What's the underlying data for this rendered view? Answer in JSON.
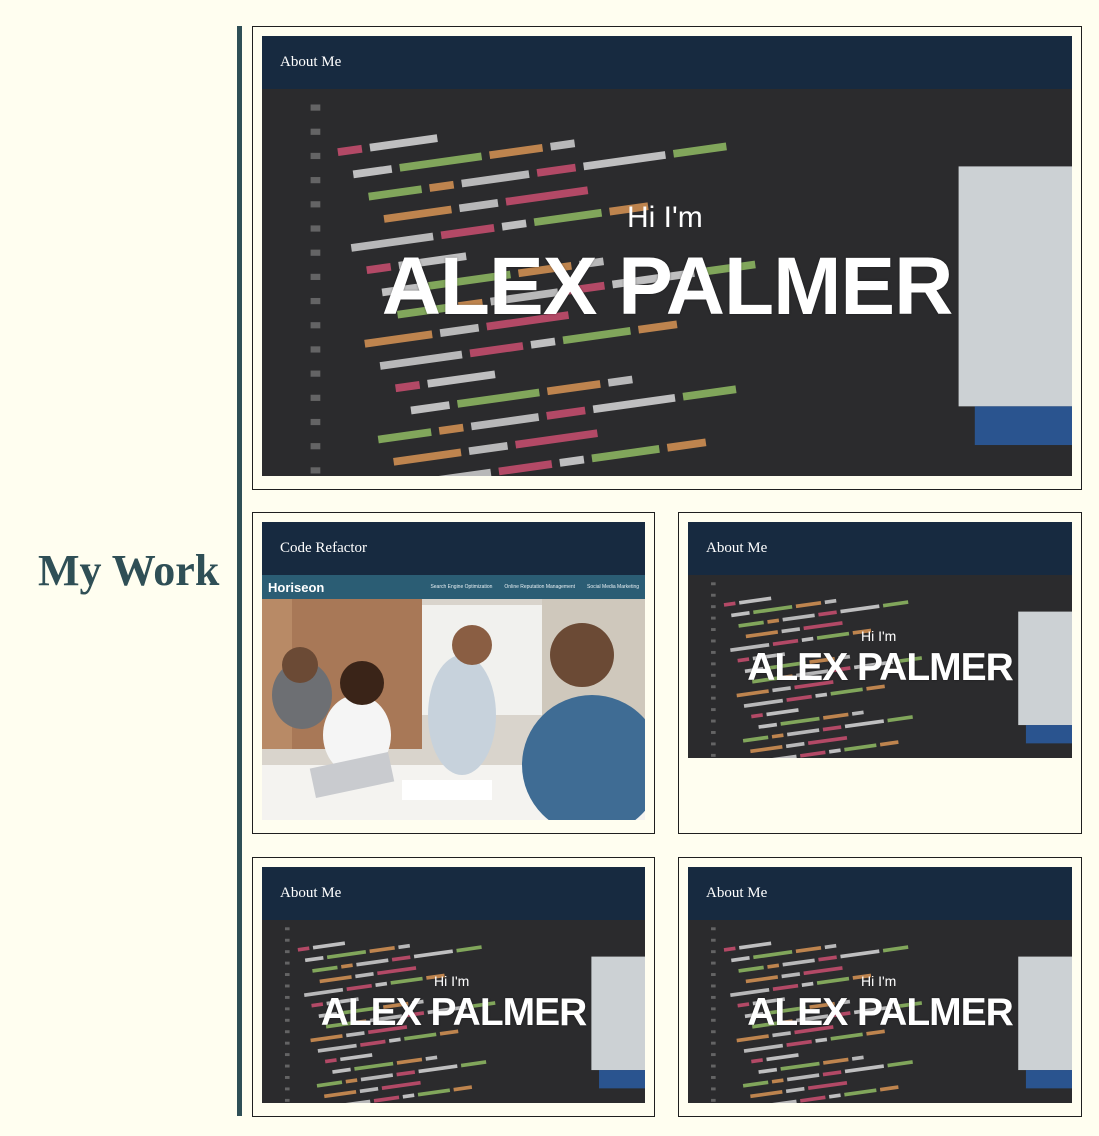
{
  "section": {
    "title": "My Work"
  },
  "projects": [
    {
      "header": "About Me",
      "greeting": "Hi I'm",
      "name": "ALEX PALMER"
    },
    {
      "header": "Code Refactor",
      "site_logo": "Horiseon",
      "nav": [
        "Search Engine Optimization",
        "Online Reputation Management",
        "Social Media Marketing"
      ]
    },
    {
      "header": "About Me",
      "greeting": "Hi I'm",
      "name": "ALEX PALMER"
    },
    {
      "header": "About Me",
      "greeting": "Hi I'm",
      "name": "ALEX PALMER"
    },
    {
      "header": "About Me",
      "greeting": "Hi I'm",
      "name": "ALEX PALMER"
    }
  ],
  "colors": {
    "page_bg": "#fffef0",
    "accent": "#2f4f56",
    "header_bg": "#172a40",
    "code_bg": "#2b2b2d"
  }
}
